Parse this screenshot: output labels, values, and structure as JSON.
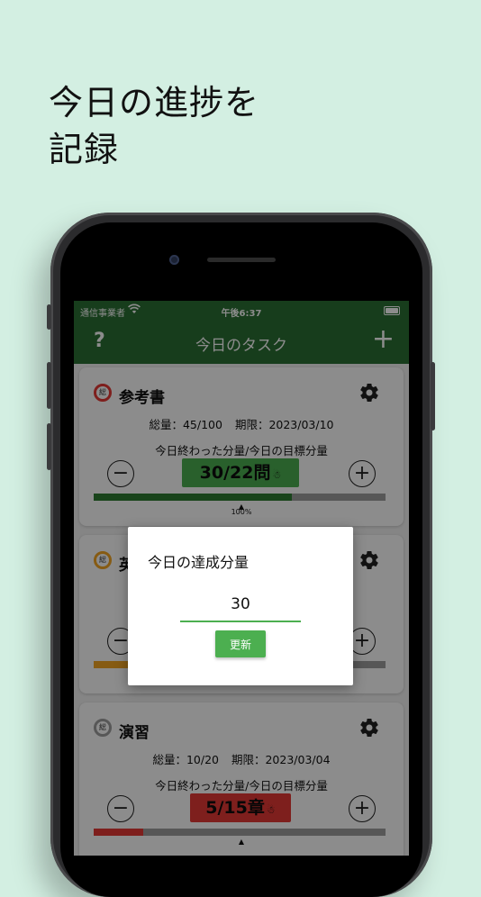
{
  "headline": {
    "line1": "今日の進捗を",
    "line2": "記録"
  },
  "status_bar": {
    "carrier": "通信事業者",
    "time": "午後6:37"
  },
  "nav": {
    "help": "?",
    "title": "今日のタスク",
    "add": "+"
  },
  "cards": [
    {
      "ring_label": "総",
      "ring_color": "#e53935",
      "name": "参考書",
      "total": "総量：45/100",
      "deadline": "期限：2023/03/10",
      "subtitle": "今日終わった分量/今日の目標分量",
      "minus": "−",
      "plus": "+",
      "progress_value": "30/22問",
      "progress_icon": "☃",
      "badge_color": "#4caf50",
      "bar_color": "#2e7d32",
      "bar_fraction": 0.68,
      "percent": "100%"
    },
    {
      "ring_label": "総",
      "ring_color": "#f5a623",
      "name": "英",
      "minus": "−",
      "plus": "+",
      "bar_color": "#f5a623",
      "bar_fraction": 0.18
    },
    {
      "ring_label": "総",
      "ring_color": "#9e9e9e",
      "name": "演習",
      "total": "総量：10/20",
      "deadline": "期限：2023/03/04",
      "subtitle": "今日終わった分量/今日の目標分量",
      "minus": "−",
      "plus": "+",
      "progress_value": "5/15章",
      "progress_icon": "☃",
      "badge_color": "#e53935",
      "bar_color": "#e53935",
      "bar_fraction": 0.17
    }
  ],
  "dialog": {
    "title": "今日の達成分量",
    "input_value": "30",
    "update_label": "更新"
  }
}
